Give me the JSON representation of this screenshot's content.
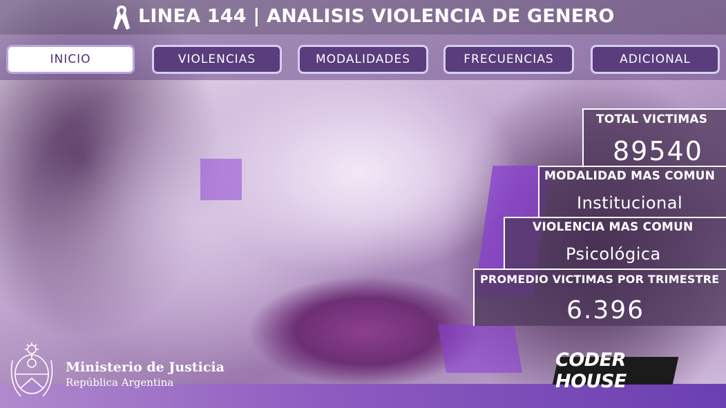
{
  "header": {
    "title": "LINEA 144 | ANALISIS VIOLENCIA DE GENERO"
  },
  "nav": {
    "active": "INICIO",
    "items": [
      {
        "label": "INICIO"
      },
      {
        "label": "VIOLENCIAS"
      },
      {
        "label": "MODALIDADES"
      },
      {
        "label": "FRECUENCIAS"
      },
      {
        "label": "ADICIONAL"
      }
    ]
  },
  "kpis": {
    "total_victimas": {
      "label": "TOTAL VICTIMAS",
      "value": "89540"
    },
    "modalidad": {
      "label": "MODALIDAD MAS COMUN",
      "value": "Institucional"
    },
    "violencia": {
      "label": "VIOLENCIA MAS COMUN",
      "value": "Psicológica"
    },
    "promedio": {
      "label": "PROMEDIO VICTIMAS POR TRIMESTRE",
      "value": "6.396"
    }
  },
  "footer": {
    "ministry_line1": "Ministerio de Justicia",
    "ministry_line2": "República Argentina",
    "partner": "CODER HOUSE"
  },
  "colors": {
    "accent_purple": "#5a3d7c",
    "active_button_bg": "#ffffff",
    "active_button_text": "#4b2e74",
    "kpi_panel": "#4e385a"
  },
  "icons": {
    "ribbon": "awareness-ribbon-icon",
    "seal": "coat-of-arms-icon"
  }
}
